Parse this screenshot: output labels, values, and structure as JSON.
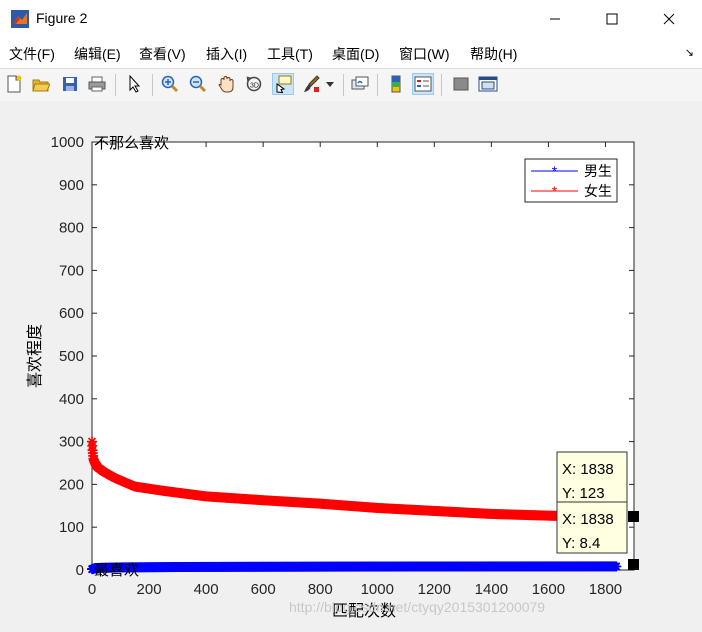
{
  "window": {
    "title": "Figure 2"
  },
  "menu": [
    "文件(F)",
    "编辑(E)",
    "查看(V)",
    "插入(I)",
    "工具(T)",
    "桌面(D)",
    "窗口(W)",
    "帮助(H)"
  ],
  "toolbar": {
    "icons": [
      "new-figure-icon",
      "open-file-icon",
      "save-icon",
      "print-icon",
      "pointer-icon",
      "zoom-in-icon",
      "zoom-out-icon",
      "pan-icon",
      "rotate-3d-icon",
      "data-cursor-icon",
      "brush-icon",
      "brush-dropdown-icon",
      "link-plot-icon",
      "colorbar-icon",
      "legend-icon",
      "hide-plot-tools-icon",
      "show-plot-tools-icon"
    ]
  },
  "chart_data": {
    "type": "scatter",
    "title": "",
    "xlabel": "匹配次数",
    "ylabel": "喜欢程度",
    "xlim": [
      0,
      1900
    ],
    "ylim": [
      0,
      1000
    ],
    "xticks": [
      "0",
      "200",
      "400",
      "600",
      "800",
      "1000",
      "1200",
      "1400",
      "1600",
      "1800"
    ],
    "yticks": [
      "0",
      "100",
      "200",
      "300",
      "400",
      "500",
      "600",
      "700",
      "800",
      "900",
      "1000"
    ],
    "annotations": {
      "top": "不那么喜欢",
      "bottom": "最喜欢"
    },
    "legend": {
      "position": "top-right"
    },
    "series": [
      {
        "name": "男生",
        "color": "#0000ff",
        "marker": "*",
        "x": [
          0,
          10,
          30,
          100,
          300,
          600,
          900,
          1200,
          1500,
          1838
        ],
        "y": [
          2,
          4,
          5,
          6,
          7,
          7.5,
          8,
          8.2,
          8.3,
          8.4
        ]
      },
      {
        "name": "女生",
        "color": "#ff0000",
        "marker": "*",
        "x": [
          0,
          2,
          5,
          10,
          20,
          40,
          80,
          150,
          250,
          400,
          600,
          800,
          1000,
          1200,
          1400,
          1600,
          1838
        ],
        "y": [
          300,
          280,
          260,
          250,
          240,
          230,
          215,
          195,
          185,
          172,
          163,
          155,
          145,
          138,
          131,
          127,
          123
        ]
      }
    ],
    "datatips": [
      {
        "x_label": "X: 1838",
        "y_label": "Y: 123"
      },
      {
        "x_label": "X: 1838",
        "y_label": "Y: 8.4"
      }
    ]
  },
  "watermark": "http://blog.csdn.net/ctyqy2015301200079"
}
